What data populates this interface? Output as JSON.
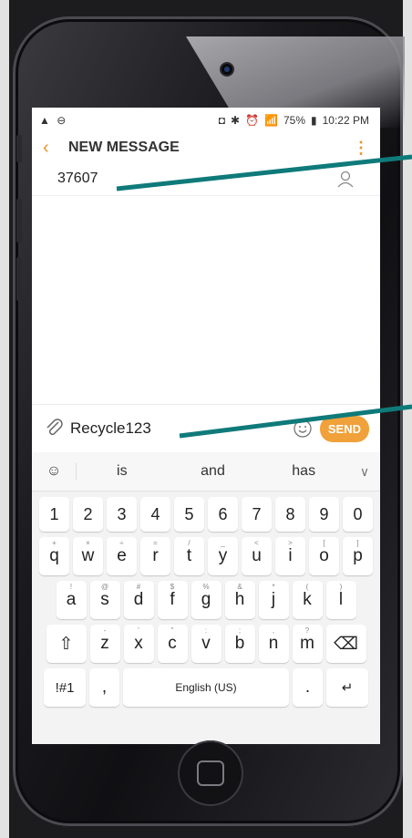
{
  "status": {
    "battery": "75%",
    "time": "10:22 PM"
  },
  "header": {
    "title": "NEW MESSAGE"
  },
  "recipient": {
    "number": "37607"
  },
  "compose": {
    "text": "Recycle123",
    "send_label": "SEND"
  },
  "suggestions": [
    "is",
    "and",
    "has"
  ],
  "keyboard": {
    "numbers": [
      "1",
      "2",
      "3",
      "4",
      "5",
      "6",
      "7",
      "8",
      "9",
      "0"
    ],
    "row1": [
      "q",
      "w",
      "e",
      "r",
      "t",
      "y",
      "u",
      "i",
      "o",
      "p"
    ],
    "row1_sub": [
      "+",
      "×",
      "÷",
      "=",
      "/",
      "_",
      "<",
      ">",
      "[",
      "]"
    ],
    "row2": [
      "a",
      "s",
      "d",
      "f",
      "g",
      "h",
      "j",
      "k",
      "l"
    ],
    "row2_sub": [
      "!",
      "@",
      "#",
      "$",
      "%",
      "&",
      "*",
      "(",
      ")"
    ],
    "row3": [
      "z",
      "x",
      "c",
      "v",
      "b",
      "n",
      "m"
    ],
    "row3_sub": [
      "-",
      "'",
      "\"",
      ":",
      ";",
      ",",
      "?"
    ],
    "symbols_label": "!#1",
    "comma_label": ",",
    "space_label": "English (US)",
    "period_label": "."
  },
  "colors": {
    "accent": "#e8942f",
    "send_bg": "#f0a13a",
    "annotation_line": "#0f7a7a"
  }
}
